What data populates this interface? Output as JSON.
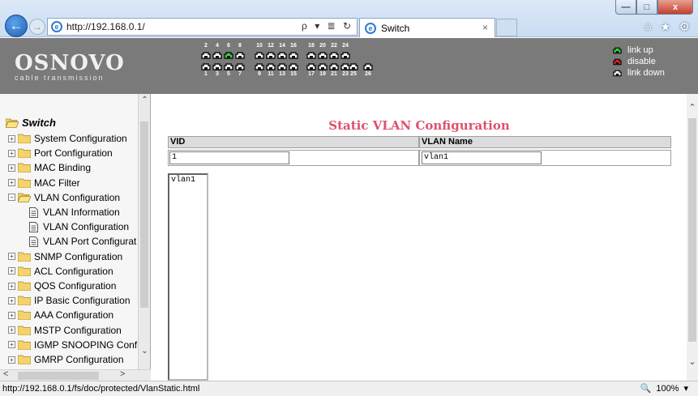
{
  "browser": {
    "url": "http://192.168.0.1/",
    "tab_title": "Switch",
    "tab_close": "×",
    "address_tools": "ρ ▾ ≣ ↻",
    "window_controls": {
      "min": "—",
      "max": "□",
      "close": "x"
    },
    "toolbar_icons": {
      "home": "⌂",
      "favorites": "★",
      "settings": "⚙"
    }
  },
  "header": {
    "logo_main": "OSNOVO",
    "logo_sub": "cable transmission",
    "ports_top_numbers": [
      "2",
      "4",
      "6",
      "8",
      "10",
      "12",
      "14",
      "16",
      "18",
      "20",
      "22",
      "24"
    ],
    "ports_bottom_numbers": [
      "1",
      "3",
      "5",
      "7",
      "9",
      "11",
      "13",
      "15",
      "17",
      "19",
      "21",
      "23",
      "25",
      "26"
    ],
    "ports_link_up": [
      "6"
    ],
    "legend": [
      {
        "label": "link up",
        "color": "#3bd33b"
      },
      {
        "label": "disable",
        "color": "#e02020"
      },
      {
        "label": "link down",
        "color": "#ffffff"
      }
    ]
  },
  "sidebar": {
    "root": "Switch",
    "items": [
      {
        "label": "System Configuration",
        "type": "folder",
        "expander": "+"
      },
      {
        "label": "Port Configuration",
        "type": "folder",
        "expander": "+"
      },
      {
        "label": "MAC Binding",
        "type": "folder",
        "expander": "+"
      },
      {
        "label": "MAC Filter",
        "type": "folder",
        "expander": "+"
      },
      {
        "label": "VLAN Configuration",
        "type": "folder-open",
        "expander": "−"
      },
      {
        "label": "VLAN Information",
        "type": "doc"
      },
      {
        "label": "VLAN Configuration",
        "type": "doc"
      },
      {
        "label": "VLAN Port Configurat",
        "type": "doc"
      },
      {
        "label": "SNMP Configuration",
        "type": "folder",
        "expander": "+"
      },
      {
        "label": "ACL Configuration",
        "type": "folder",
        "expander": "+"
      },
      {
        "label": "QOS Configuration",
        "type": "folder",
        "expander": "+"
      },
      {
        "label": "IP Basic Configuration",
        "type": "folder",
        "expander": "+"
      },
      {
        "label": "AAA Configuration",
        "type": "folder",
        "expander": "+"
      },
      {
        "label": "MSTP Configuration",
        "type": "folder",
        "expander": "+"
      },
      {
        "label": "IGMP SNOOPING Confi",
        "type": "folder",
        "expander": "+"
      },
      {
        "label": "GMRP Configuration",
        "type": "folder",
        "expander": "+"
      }
    ]
  },
  "main": {
    "title": "Static VLAN Configuration",
    "col_vid": "VID",
    "col_vlan_name": "VLAN Name",
    "vid_value": "1",
    "vlan_name_value": "vlan1",
    "vlan_list": [
      "vlan1"
    ]
  },
  "statusbar": {
    "url": "http://192.168.0.1/fs/doc/protected/VlanStatic.html",
    "zoom": "100%",
    "zoom_icon": "🔍",
    "zoom_dropdown": "▾"
  },
  "scroll_arrows": {
    "up": "⌃",
    "down": "⌄",
    "left": "<",
    "right": ">"
  },
  "colors": {
    "accent_title": "#e0506a",
    "header_bg": "#7a7a7a",
    "link_up": "#3bd33b",
    "disable": "#e02020"
  }
}
